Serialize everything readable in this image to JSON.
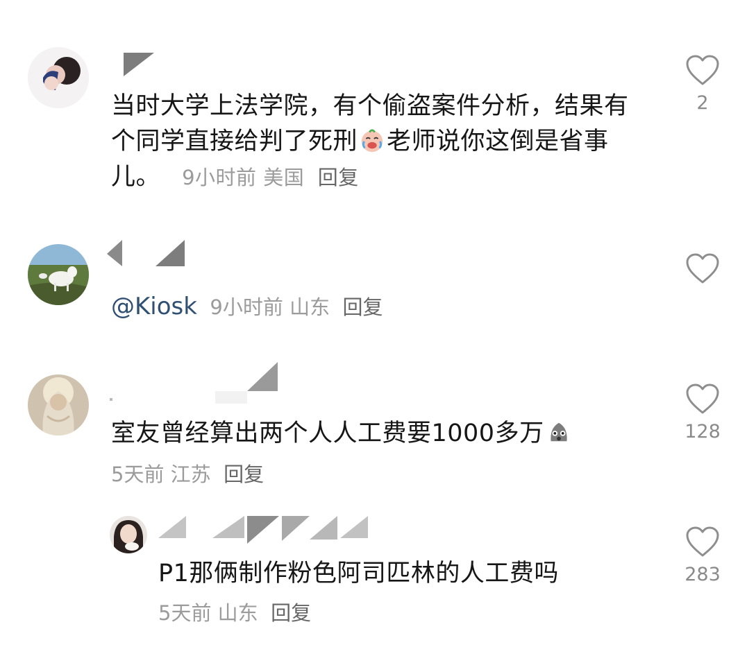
{
  "comments": [
    {
      "text_before": "当时大学上法学院，有个偷盗案件分析，结果有个同学直接给判了死刑",
      "emoji": "laughing-crying-emoji",
      "text_after": "老师说你这倒是省事儿。",
      "time": "9小时前",
      "location": "美国",
      "reply_label": "回复",
      "likes": "2"
    },
    {
      "mention": "@Kiosk",
      "time": "9小时前",
      "location": "山东",
      "reply_label": "回复",
      "likes": ""
    },
    {
      "text": "室友曾经算出两个人人工费要1000多万",
      "emoji": "shocked-face-emoji",
      "time": "5天前",
      "location": "江苏",
      "reply_label": "回复",
      "likes": "128"
    },
    {
      "text": "P1那俩制作粉色阿司匹林的人工费吗",
      "time": "5天前",
      "location": "山东",
      "reply_label": "回复",
      "likes": "283"
    }
  ],
  "colors": {
    "text": "#161616",
    "meta": "#9b9b9b",
    "reply": "#666666",
    "mention": "#2f4f73",
    "heart_outline": "#8e8e8e"
  }
}
